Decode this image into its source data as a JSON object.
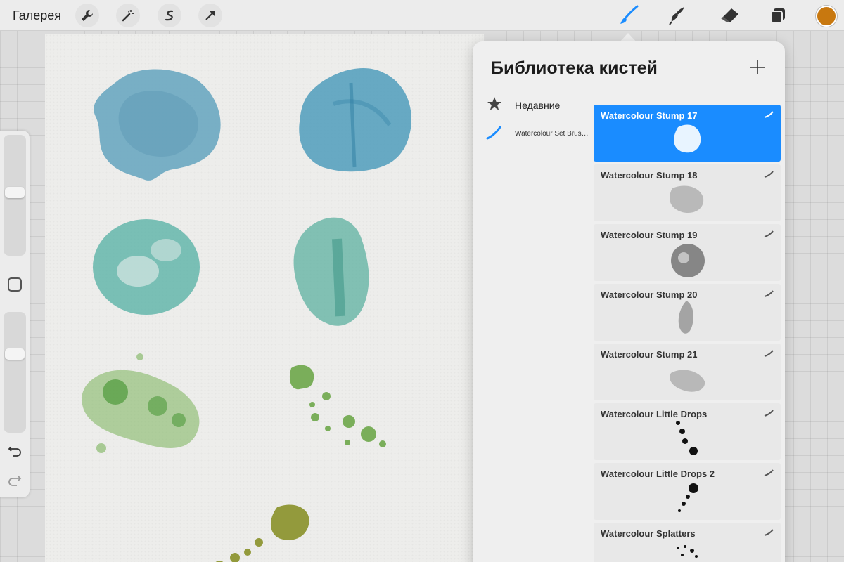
{
  "topbar": {
    "gallery_label": "Галерея",
    "left_tools": [
      "wrench-icon",
      "magic-wand-icon",
      "selection-icon",
      "transform-arrow-icon"
    ],
    "right_tools": [
      "brush-icon",
      "smudge-icon",
      "eraser-icon",
      "layers-icon"
    ],
    "current_color": "#c8780f"
  },
  "library": {
    "title": "Библиотека кистей",
    "sets": [
      {
        "label": "Недавние",
        "icon": "star-icon"
      },
      {
        "label": "Watercolour Set Brus…",
        "icon": "brush-stroke-icon"
      }
    ],
    "brushes": [
      {
        "name": "Watercolour Stump 17",
        "selected": true
      },
      {
        "name": "Watercolour Stump 18",
        "selected": false
      },
      {
        "name": "Watercolour Stump 19",
        "selected": false
      },
      {
        "name": "Watercolour Stump 20",
        "selected": false
      },
      {
        "name": "Watercolour Stump 21",
        "selected": false
      },
      {
        "name": "Watercolour Little Drops",
        "selected": false
      },
      {
        "name": "Watercolour Little Drops 2",
        "selected": false
      },
      {
        "name": "Watercolour Splatters",
        "selected": false
      }
    ],
    "accent_color": "#1a8cff"
  }
}
